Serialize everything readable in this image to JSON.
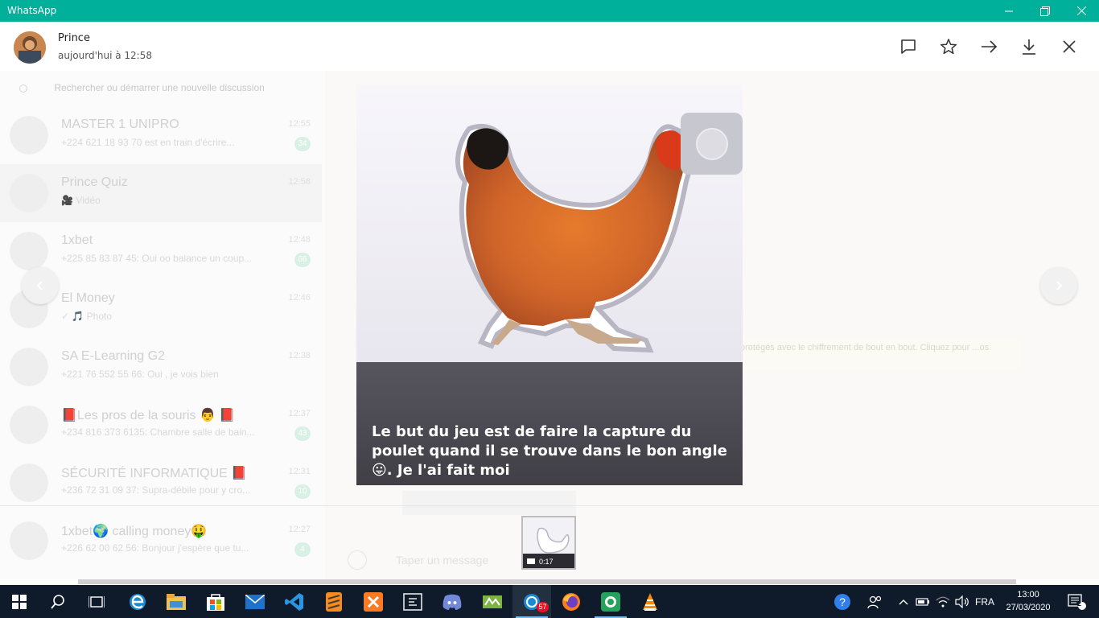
{
  "window": {
    "title": "WhatsApp",
    "controls": [
      "minimize",
      "maximize",
      "close"
    ]
  },
  "viewer": {
    "sender_name": "Prince",
    "timestamp": "aujourd'hui à 12:58",
    "actions": [
      "reply-icon",
      "star-icon",
      "forward-icon",
      "download-icon",
      "close-icon"
    ],
    "caption": "Le but du jeu est de faire la capture du poulet quand il se trouve dans le bon angle 😛. Je l'ai fait moi",
    "thumbnail_duration": "0:17"
  },
  "background_chats": [
    {
      "name": "MASTER 1 UNIPRO",
      "time": "12:55",
      "last": "+224 621 18 93 70 est en train d'écrire...",
      "badge": "34"
    },
    {
      "name": "Prince Quiz",
      "time": "12:58",
      "last": "🎥 Vidéo",
      "badge": ""
    },
    {
      "name": "1xbet",
      "time": "12:48",
      "last": "+225 85 83 87 45: Oui oo balance un coup...",
      "badge": "66"
    },
    {
      "name": "El Money",
      "time": "12:46",
      "last": "✓ 🎵 Photo",
      "badge": ""
    },
    {
      "name": "SA E-Learning G2",
      "time": "12:38",
      "last": "+221 76 552 55 66: Oui , je vois bien",
      "badge": ""
    },
    {
      "name": "📕Les pros de la souris 👨 📕",
      "time": "12:37",
      "last": "+234 816 373 6135: Chambre salle de bain...",
      "badge": "43"
    },
    {
      "name": "SÉCURITÉ INFORMATIQUE 📕",
      "time": "12:31",
      "last": "+236 72 31 09 37: Supra-débile pour y cro...",
      "badge": "10"
    },
    {
      "name": "1xbet🌍 calling money🤑",
      "time": "12:27",
      "last": "+226 62 00 62 56: Bonjour j'espère que tu...",
      "badge": "4"
    }
  ],
  "background": {
    "search_placeholder": "Rechercher ou démarrer une nouvelle discussion",
    "encryption_notice": "protégés avec le chiffrement de bout en bout. Cliquez pour ...os",
    "compose_placeholder": "Taper un message"
  },
  "taskbar": {
    "apps": [
      "start-icon",
      "search-icon",
      "task-view-icon",
      "edge-icon",
      "file-explorer-icon",
      "store-icon",
      "mail-icon",
      "vscode-icon",
      "sublime-icon",
      "xampp-icon",
      "app-icon",
      "discord-icon",
      "app-icon",
      "whatsapp-icon",
      "firefox-icon",
      "whatsapp-icon",
      "vlc-icon"
    ],
    "notification_badge": "57",
    "language": "FRA",
    "time": "13:00",
    "date": "27/03/2020",
    "action_center_count": "2"
  },
  "colors": {
    "accent": "#00b09b",
    "taskbar": "#0f1b2a"
  }
}
